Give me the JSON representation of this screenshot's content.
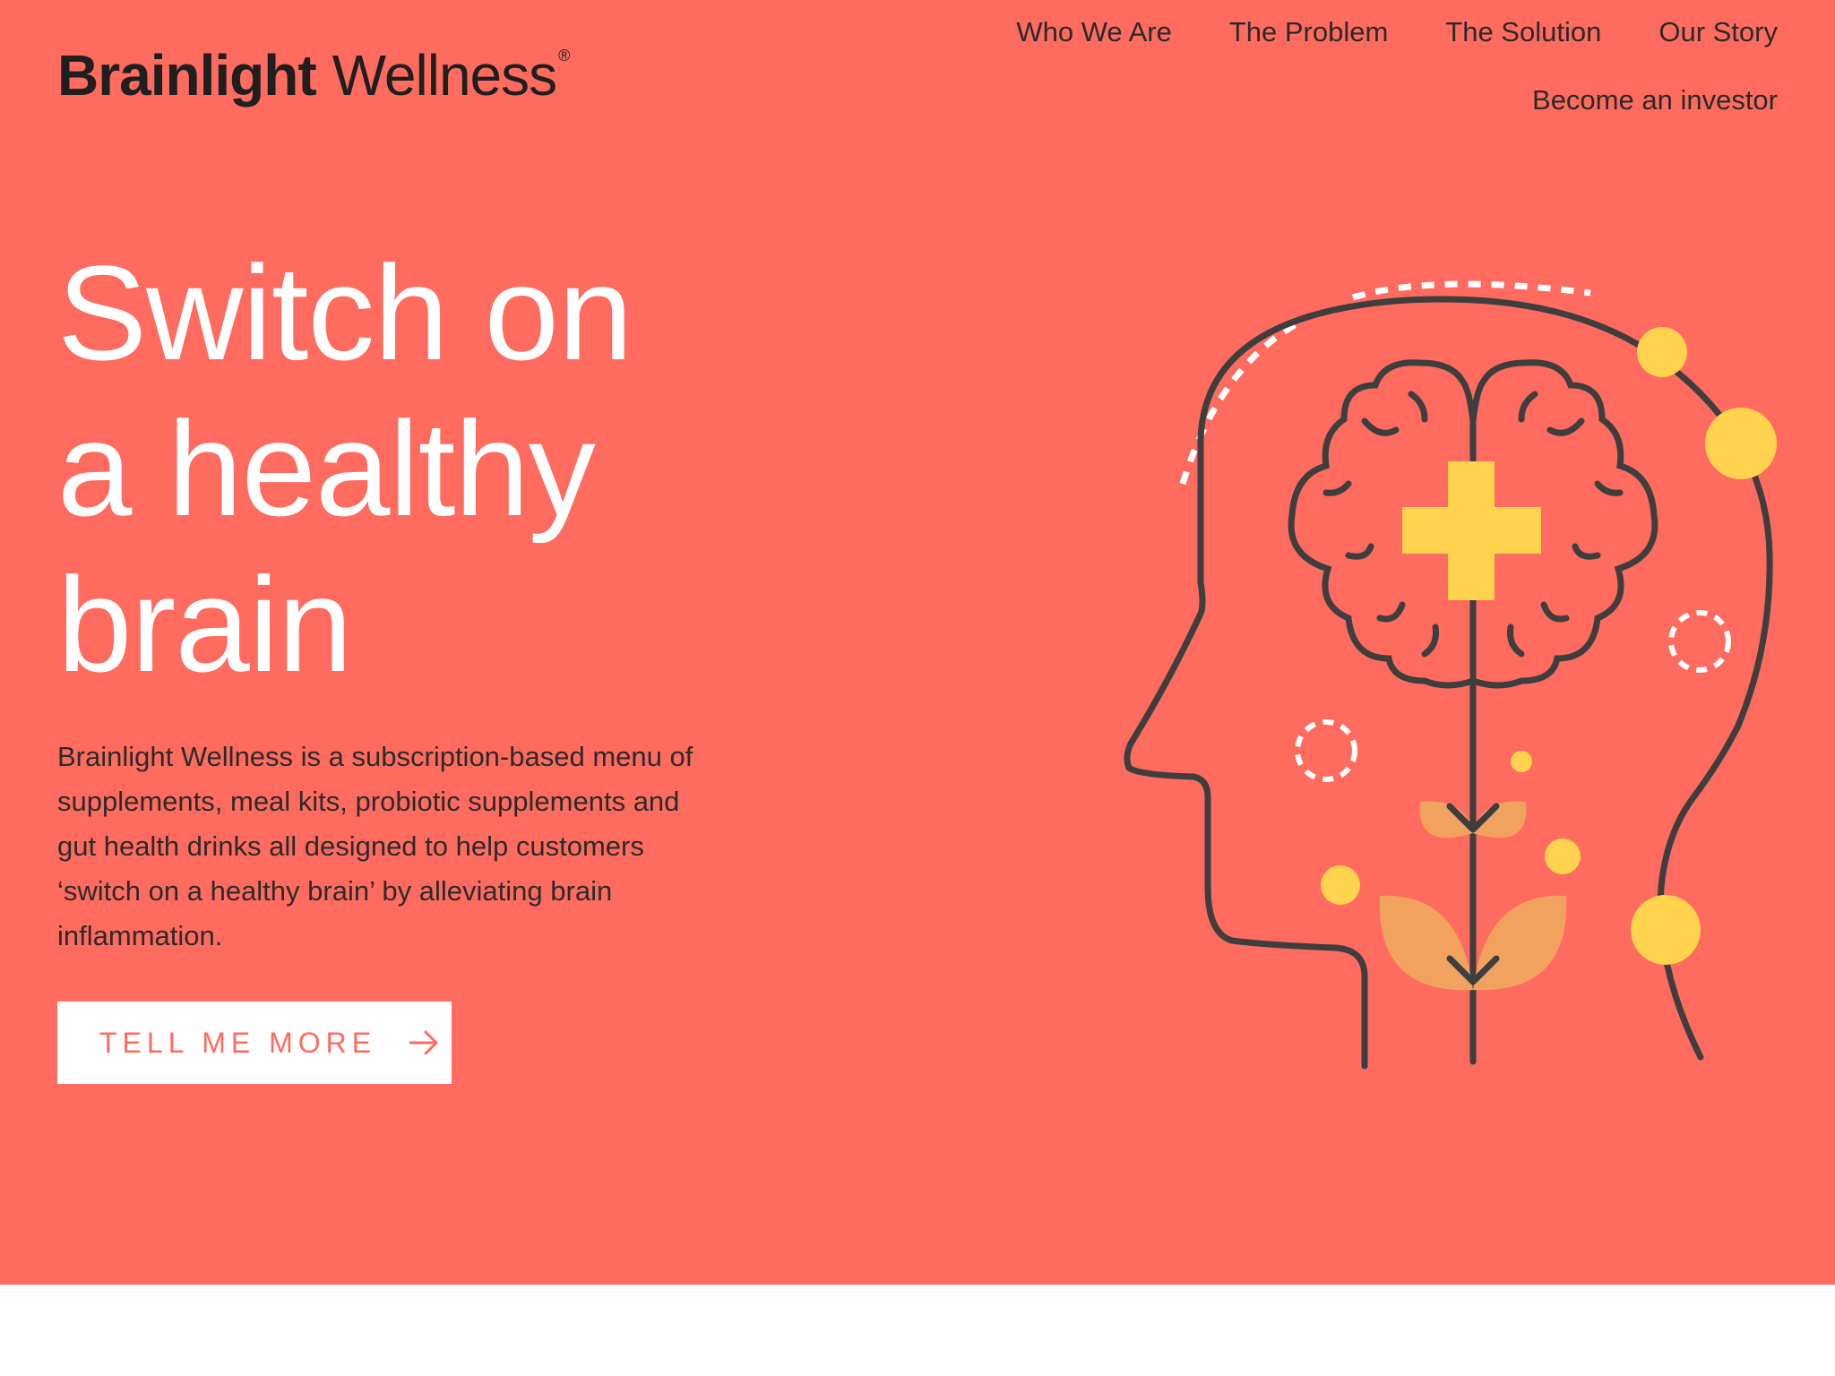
{
  "brand": {
    "name_bold": "Brainlight",
    "name_light": "Wellness",
    "registered_mark": "®"
  },
  "nav": {
    "items": [
      {
        "label": "Who We Are"
      },
      {
        "label": "The Problem"
      },
      {
        "label": "The Solution"
      },
      {
        "label": "Our Story"
      },
      {
        "label": "Become an investor"
      }
    ]
  },
  "hero": {
    "headline_lines": [
      "Switch on",
      "a healthy",
      "brain"
    ],
    "description": "Brainlight Wellness is a subscription-based menu of supplements, meal kits, probiotic supplements and gut health drinks all designed to help customers ‘switch on a healthy brain’ by alleviating brain inflammation.",
    "cta_label": "TELL ME MORE",
    "cta_icon": "arrow-right-icon",
    "illustration_icon": "head-brain-plant-illustration"
  },
  "colors": {
    "hero_background": "#ff6b5e",
    "text_dark": "#2b2b2b",
    "text_light": "#ffffff",
    "accent_yellow": "#ffd34e",
    "leaf_orange": "#f0a25e",
    "line_dark": "#3e3e3e",
    "page_background": "#ffffff"
  }
}
